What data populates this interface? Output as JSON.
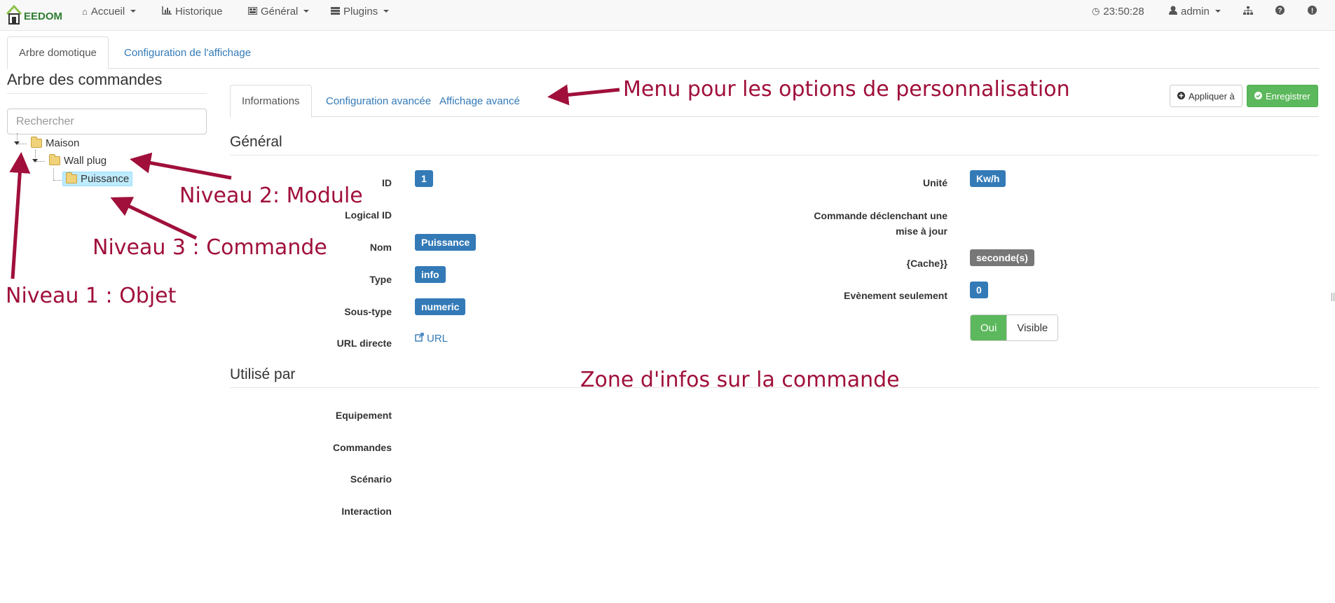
{
  "navbar": {
    "logo_text": "EEDOM",
    "menu": [
      {
        "label": "Accueil",
        "icon": "home-icon"
      },
      {
        "label": "Historique",
        "icon": "bar-chart-icon"
      },
      {
        "label": "Général",
        "icon": "dashboard-icon"
      },
      {
        "label": "Plugins",
        "icon": "list-icon"
      }
    ],
    "clock": "23:50:28",
    "user": "admin"
  },
  "tabs": [
    {
      "label": "Arbre domotique",
      "active": true
    },
    {
      "label": "Configuration de l'affichage",
      "active": false
    }
  ],
  "tree": {
    "title": "Arbre des commandes",
    "search_placeholder": "Rechercher",
    "nodes": [
      {
        "label": "Maison",
        "level": 1
      },
      {
        "label": "Wall plug",
        "level": 2
      },
      {
        "label": "Puissance",
        "level": 3,
        "selected": true
      }
    ]
  },
  "subtabs": [
    {
      "label": "Informations",
      "active": true
    },
    {
      "label": "Configuration avancée",
      "active": false
    },
    {
      "label": "Affichage avancé",
      "active": false
    }
  ],
  "buttons": {
    "apply": "Appliquer à",
    "save": "Enregistrer"
  },
  "general": {
    "title": "Général",
    "left": [
      {
        "label": "ID",
        "value": "1"
      },
      {
        "label": "Logical ID",
        "value": ""
      },
      {
        "label": "Nom",
        "value": "Puissance"
      },
      {
        "label": "Type",
        "value": "info"
      },
      {
        "label": "Sous-type",
        "value": "numeric"
      },
      {
        "label": "URL directe",
        "value": "URL"
      }
    ],
    "right": [
      {
        "label": "Unité",
        "value": "Kw/h"
      },
      {
        "label": "Commande déclenchant une mise à jour",
        "value": ""
      },
      {
        "label": "{Cache}}",
        "value": "seconde(s)"
      },
      {
        "label": "Evènement seulement",
        "value": "0"
      }
    ],
    "toggle": {
      "on": "Oui",
      "off": "Visible"
    }
  },
  "used_by": {
    "title": "Utilisé par",
    "rows": [
      "Equipement",
      "Commandes",
      "Scénario",
      "Interaction"
    ]
  },
  "annotations": {
    "menu": "Menu pour les options de personnalisation",
    "level2": "Niveau 2: Module",
    "level3": "Niveau 3 : Commande",
    "level1": "Niveau 1 : Objet",
    "zone": "Zone d'infos sur la commande"
  },
  "colors": {
    "annotation": "#a0103a",
    "primary": "#337ab7",
    "success": "#5cb85c"
  }
}
